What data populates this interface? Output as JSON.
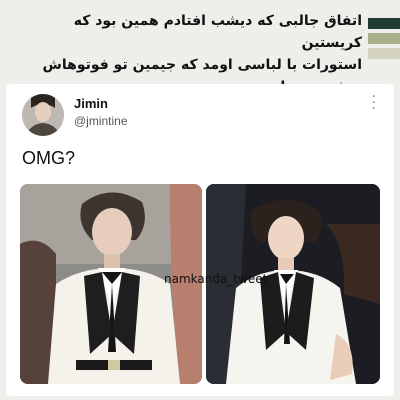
{
  "headline": {
    "line1": "اتفاق جالبی که دیشب افتادم همین بود که کریستین",
    "line2": "استورات با لباسی اومد که جیمین تو فوتوهاش پوشیده بود!"
  },
  "tweet": {
    "display_name": "Jimin",
    "handle": "@jmintine",
    "text": "OMG?",
    "menu_icon": "more-vertical-icon",
    "avatar_icon": "profile-photo"
  },
  "watermark": "namkanda_tweet",
  "colors": {
    "background": "#eeeeea",
    "stripe_1": "#1f3b33",
    "stripe_2": "#aab08a",
    "stripe_3": "#d4d3c0"
  }
}
